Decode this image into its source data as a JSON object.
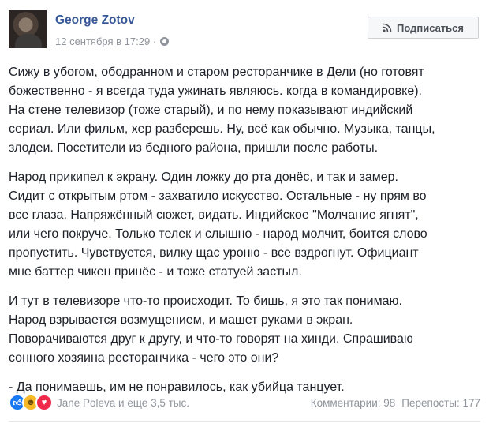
{
  "post": {
    "author": "George Zotov",
    "timestamp": "12 сентября в 17:29 ·",
    "subscribe_label": "Подписаться",
    "paragraphs": [
      [
        "Сижу в убогом, ободранном и старом ресторанчике в Дели (но готовят",
        "божественно - я всегда туда ужинать являюсь. когда в командировке).",
        "На стене телевизор (тоже старый), и по нему показывают индийский",
        "сериал. Или фильм, хер разберешь. Ну, всё как обычно. Музыка, танцы,",
        "злодеи. Посетители из бедного района, пришли после работы."
      ],
      [
        "Народ прикипел к экрану. Один ложку до рта донёс, и так и замер.",
        "Сидит с открытым ртом - захватило искусство. Остальные - ну прям во",
        "все глаза. Напряжённый сюжет, видать. Индийское \"Молчание ягнят\",",
        "или чего покруче. Только телек и слышно - народ молчит, боится слово",
        "пропустить. Чувствуется, вилку щас уроню - все вздрогнут. Официант",
        "мне баттер чикен принёс - и тоже статуей застыл."
      ],
      [
        "И тут в телевизоре что-то происходит. То бишь, я это так понимаю.",
        "Народ взрывается возмущением, и машет руками в экран.",
        "Поворачиваются друг к другу, и что-то говорят на хинди. Спрашиваю",
        "сонного хозяина ресторанчика - чего это они?"
      ],
      [
        "- Да понимаешь, им не понравилось, как убийца танцует."
      ]
    ],
    "reactions_text": "Jane Poleva и еще 3,5 тыс.",
    "comments": "Комментарии: 98",
    "shares": "Перепосты: 177"
  },
  "colors": {
    "link": "#365899",
    "muted": "#90949c",
    "text": "#1d2129",
    "like": "#1877f2",
    "haha": "#f7b928",
    "love": "#f0284a"
  },
  "icons": [
    "globe-icon",
    "rss-icon",
    "like-icon",
    "haha-icon",
    "love-icon"
  ]
}
